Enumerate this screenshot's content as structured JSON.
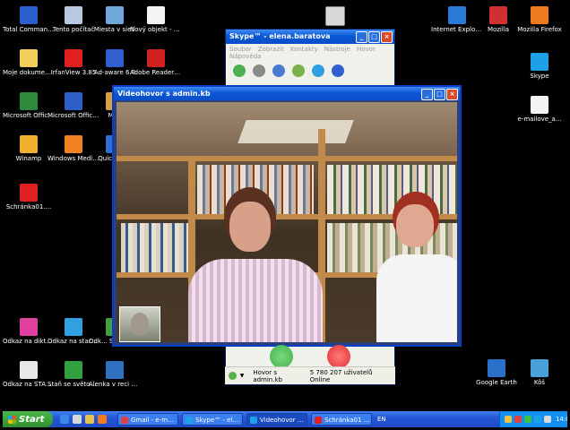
{
  "desktop": {
    "icons_left": [
      {
        "label": "Total Commander",
        "color": "#2b5fd0",
        "icon": "total-commander-icon"
      },
      {
        "label": "Tento počítač",
        "color": "#b8c8e0",
        "icon": "computer-icon"
      },
      {
        "label": "Miesta v sieti",
        "color": "#6fa8d8",
        "icon": "network-icon"
      },
      {
        "label": "Nový objekt - Textový d...",
        "color": "#f4f4f4",
        "icon": "text-document-icon"
      },
      {
        "label": "Moje dokumenty",
        "color": "#f1cf5a",
        "icon": "my-documents-icon"
      },
      {
        "label": "IrfanView 3.85",
        "color": "#e02020",
        "icon": "irfanview-icon"
      },
      {
        "label": "Ad-aware 6.0",
        "color": "#3060d0",
        "icon": "adaware-icon"
      },
      {
        "label": "Adobe Reader 7.0",
        "color": "#d02020",
        "icon": "adobe-reader-icon"
      },
      {
        "label": "Microsoft Office Ex...",
        "color": "#2c8a3a",
        "icon": "excel-icon"
      },
      {
        "label": "Microsoft Office W...",
        "color": "#2f5ec8",
        "icon": "word-icon"
      },
      {
        "label": "Mi...",
        "color": "#d8a040",
        "icon": "office-icon"
      },
      {
        "label": "Winamp",
        "color": "#f0b030",
        "icon": "winamp-icon"
      },
      {
        "label": "Windows Media Player",
        "color": "#f08020",
        "icon": "media-player-icon"
      },
      {
        "label": "Quic... Pl...",
        "color": "#3070d0",
        "icon": "quicktime-icon"
      },
      {
        "label": "Schránka01....",
        "color": "#e02020",
        "icon": "clipboard-icon"
      },
      {
        "label": "Odkaz na diktaty.exe",
        "color": "#e040a0",
        "icon": "shortcut-icon"
      },
      {
        "label": "Odkaz na start_aj_nj....",
        "color": "#30a0e0",
        "icon": "shortcut-icon"
      },
      {
        "label": "Odk... SJL_S...me...",
        "color": "#40a040",
        "icon": "shortcut-icon"
      },
      {
        "label": "Odkaz na START.EXE",
        "color": "#e8e8e8",
        "icon": "shortcut-icon"
      },
      {
        "label": "Staň se světoběžníkem",
        "color": "#30a040",
        "icon": "shortcut-icon"
      },
      {
        "label": "Alenka v reci okolo nás",
        "color": "#3070c0",
        "icon": "shortcut-icon"
      }
    ],
    "icons_right": [
      {
        "label": "Internet Explorer",
        "color": "#2a7ad8",
        "icon": "internet-explorer-icon"
      },
      {
        "label": "Mozilla",
        "color": "#d03030",
        "icon": "mozilla-icon"
      },
      {
        "label": "Mozilla Firefox",
        "color": "#f07a20",
        "icon": "firefox-icon"
      },
      {
        "label": "Skype",
        "color": "#1ea0e8",
        "icon": "skype-icon"
      },
      {
        "label": "e-mailove_a...",
        "color": "#f4f4f4",
        "icon": "text-document-icon"
      },
      {
        "label": "Google Earth",
        "color": "#2a70c8",
        "icon": "google-earth-icon"
      },
      {
        "label": "Kôš",
        "color": "#4aa0d8",
        "icon": "recycle-bin-icon"
      }
    ],
    "printer": {
      "label": "",
      "icon": "printer-icon"
    }
  },
  "skype_main": {
    "title": "Skype™ - elena.baratova",
    "menu": [
      "Soubor",
      "Zobrazit",
      "Kontakty",
      "Nástroje",
      "Hovor",
      "Nápověda"
    ],
    "status_text": "Hovor s admin.kb",
    "online_text": "5 780 207 uživatelů Online"
  },
  "video_window": {
    "title": "Videohovor s admin.kb"
  },
  "taskbar": {
    "start_label": "Start",
    "tasks": [
      {
        "label": "Gmail - e-mail...",
        "color": "#e04040",
        "active": false
      },
      {
        "label": "Skype™ - ele...",
        "color": "#1ea0e8",
        "active": false
      },
      {
        "label": "Videohovor s ...",
        "color": "#1ea0e8",
        "active": true
      },
      {
        "label": "Schránka01 - ...",
        "color": "#e02020",
        "active": false
      }
    ],
    "language": "EN",
    "clock": "14:0"
  },
  "colors": {
    "xp_blue": "#0b57d5",
    "start_green": "#2f8f2f",
    "call_green": "#3cb54a",
    "call_red": "#e23030"
  }
}
